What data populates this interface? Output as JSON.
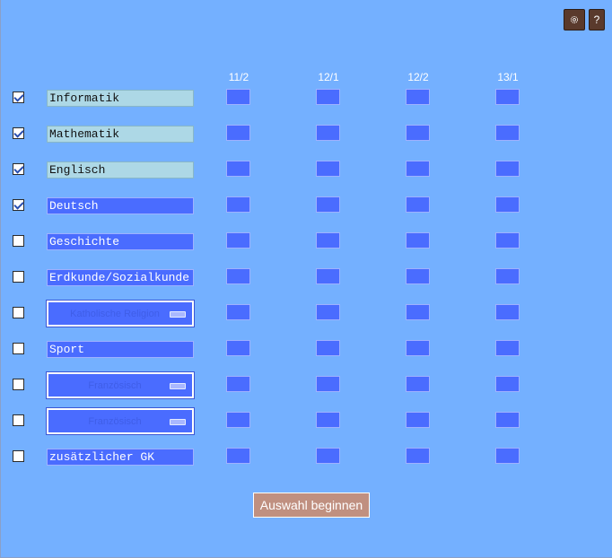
{
  "toolbar": {
    "help_label": "?"
  },
  "columns": [
    "11/2",
    "12/1",
    "12/2",
    "13/1"
  ],
  "rows": [
    {
      "type": "text",
      "label": "Informatik",
      "checked": true,
      "highlight": true
    },
    {
      "type": "text",
      "label": "Mathematik",
      "checked": true,
      "highlight": true
    },
    {
      "type": "text",
      "label": "Englisch",
      "checked": true,
      "highlight": true
    },
    {
      "type": "text",
      "label": "Deutsch",
      "checked": true,
      "highlight": false
    },
    {
      "type": "text",
      "label": "Geschichte",
      "checked": false,
      "highlight": false
    },
    {
      "type": "text",
      "label": "Erdkunde/Sozialkunde",
      "checked": false,
      "highlight": false
    },
    {
      "type": "select",
      "label": "Katholische Religion",
      "checked": false
    },
    {
      "type": "text",
      "label": "Sport",
      "checked": false,
      "highlight": false
    },
    {
      "type": "select",
      "label": "Französisch",
      "checked": false
    },
    {
      "type": "select",
      "label": "Französisch",
      "checked": false
    },
    {
      "type": "text",
      "label": "zusätzlicher GK",
      "checked": false,
      "highlight": false
    }
  ],
  "start_button": {
    "label": "Auswahl beginnen"
  },
  "colors": {
    "background": "#74b0ff",
    "field": "#4a6cff",
    "field_selected": "#add8e6",
    "button": "#c09080",
    "toolbar_button": "#5a3a2c"
  },
  "icons": {
    "settings": "settings-gear-icon",
    "help": "help-icon"
  }
}
